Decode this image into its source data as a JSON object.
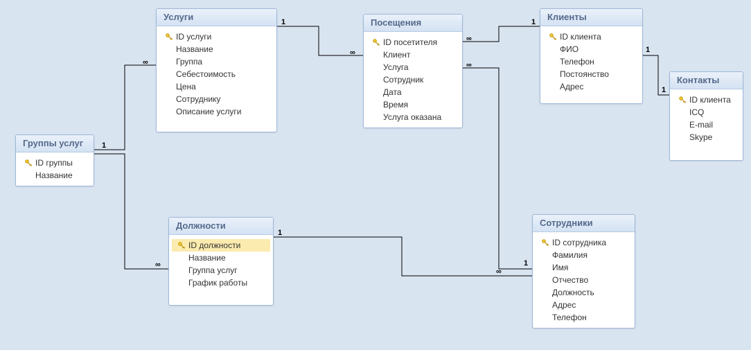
{
  "cardinality": {
    "one": "1",
    "many": "∞"
  },
  "entities": [
    {
      "id": "groups",
      "title": "Группы услуг",
      "fields": [
        {
          "name": "ID группы",
          "pk": true
        },
        {
          "name": "Название"
        }
      ]
    },
    {
      "id": "services",
      "title": "Услуги",
      "fields": [
        {
          "name": "ID услуги",
          "pk": true
        },
        {
          "name": "Название"
        },
        {
          "name": "Группа"
        },
        {
          "name": "Себестоимость"
        },
        {
          "name": "Цена"
        },
        {
          "name": "Сотруднику"
        },
        {
          "name": "Описание услуги"
        }
      ]
    },
    {
      "id": "visits",
      "title": "Посещения",
      "fields": [
        {
          "name": "ID посетителя",
          "pk": true
        },
        {
          "name": "Клиент"
        },
        {
          "name": "Услуга"
        },
        {
          "name": "Сотрудник"
        },
        {
          "name": "Дата"
        },
        {
          "name": "Время"
        },
        {
          "name": "Услуга оказана"
        }
      ]
    },
    {
      "id": "clients",
      "title": "Клиенты",
      "fields": [
        {
          "name": "ID клиента",
          "pk": true
        },
        {
          "name": "ФИО"
        },
        {
          "name": "Телефон"
        },
        {
          "name": "Постоянство"
        },
        {
          "name": "Адрес"
        }
      ]
    },
    {
      "id": "contacts",
      "title": "Контакты",
      "fields": [
        {
          "name": "ID клиента",
          "pk": true
        },
        {
          "name": "ICQ"
        },
        {
          "name": "E-mail"
        },
        {
          "name": "Skype"
        }
      ]
    },
    {
      "id": "positions",
      "title": "Должности",
      "fields": [
        {
          "name": "ID должности",
          "pk": true,
          "selected": true
        },
        {
          "name": "Название"
        },
        {
          "name": "Группа услуг"
        },
        {
          "name": "График работы"
        }
      ]
    },
    {
      "id": "employees",
      "title": "Сотрудники",
      "fields": [
        {
          "name": "ID сотрудника",
          "pk": true
        },
        {
          "name": "Фамилия"
        },
        {
          "name": "Имя"
        },
        {
          "name": "Отчество"
        },
        {
          "name": "Должность"
        },
        {
          "name": "Адрес"
        },
        {
          "name": "Телефон"
        }
      ]
    }
  ],
  "relationships": [
    {
      "from": "groups",
      "to": "services",
      "from_card": "1",
      "to_card": "∞"
    },
    {
      "from": "groups",
      "to": "positions",
      "from_card": "1",
      "to_card": "∞"
    },
    {
      "from": "services",
      "to": "visits",
      "from_card": "1",
      "to_card": "∞"
    },
    {
      "from": "clients",
      "to": "visits",
      "from_card": "1",
      "to_card": "∞"
    },
    {
      "from": "employees",
      "to": "visits",
      "from_card": "1",
      "to_card": "∞"
    },
    {
      "from": "positions",
      "to": "employees",
      "from_card": "1",
      "to_card": "∞"
    },
    {
      "from": "clients",
      "to": "contacts",
      "from_card": "1",
      "to_card": "1"
    }
  ]
}
